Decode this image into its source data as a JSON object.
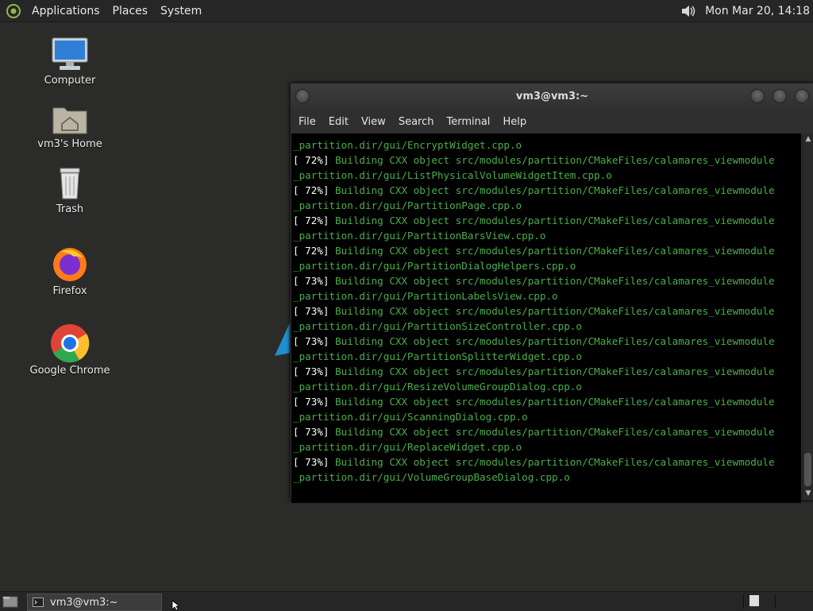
{
  "top_panel": {
    "menus": [
      "Applications",
      "Places",
      "System"
    ],
    "clock": "Mon Mar 20, 14:18"
  },
  "desktop": {
    "icons": [
      {
        "label": "Computer",
        "icon": "computer-icon"
      },
      {
        "label": "vm3's Home",
        "icon": "home-folder-icon"
      },
      {
        "label": "Trash",
        "icon": "trash-icon"
      },
      {
        "label": "Firefox",
        "icon": "firefox-icon"
      },
      {
        "label": "Google Chrome",
        "icon": "chrome-icon"
      }
    ]
  },
  "terminal": {
    "title": "vm3@vm3:~",
    "menu": [
      "File",
      "Edit",
      "View",
      "Search",
      "Terminal",
      "Help"
    ],
    "lines": [
      {
        "pct": "",
        "text": "",
        "cont": "_partition.dir/gui/EncryptWidget.cpp.o"
      },
      {
        "pct": "[ 72%]",
        "text": " Building CXX object src/modules/partition/CMakeFiles/calamares_viewmodule",
        "cont": ""
      },
      {
        "pct": "",
        "text": "",
        "cont": "_partition.dir/gui/ListPhysicalVolumeWidgetItem.cpp.o"
      },
      {
        "pct": "[ 72%]",
        "text": " Building CXX object src/modules/partition/CMakeFiles/calamares_viewmodule",
        "cont": ""
      },
      {
        "pct": "",
        "text": "",
        "cont": "_partition.dir/gui/PartitionPage.cpp.o"
      },
      {
        "pct": "[ 72%]",
        "text": " Building CXX object src/modules/partition/CMakeFiles/calamares_viewmodule",
        "cont": ""
      },
      {
        "pct": "",
        "text": "",
        "cont": "_partition.dir/gui/PartitionBarsView.cpp.o"
      },
      {
        "pct": "[ 72%]",
        "text": " Building CXX object src/modules/partition/CMakeFiles/calamares_viewmodule",
        "cont": ""
      },
      {
        "pct": "",
        "text": "",
        "cont": "_partition.dir/gui/PartitionDialogHelpers.cpp.o"
      },
      {
        "pct": "[ 73%]",
        "text": " Building CXX object src/modules/partition/CMakeFiles/calamares_viewmodule",
        "cont": ""
      },
      {
        "pct": "",
        "text": "",
        "cont": "_partition.dir/gui/PartitionLabelsView.cpp.o"
      },
      {
        "pct": "[ 73%]",
        "text": " Building CXX object src/modules/partition/CMakeFiles/calamares_viewmodule",
        "cont": ""
      },
      {
        "pct": "",
        "text": "",
        "cont": "_partition.dir/gui/PartitionSizeController.cpp.o"
      },
      {
        "pct": "[ 73%]",
        "text": " Building CXX object src/modules/partition/CMakeFiles/calamares_viewmodule",
        "cont": ""
      },
      {
        "pct": "",
        "text": "",
        "cont": "_partition.dir/gui/PartitionSplitterWidget.cpp.o"
      },
      {
        "pct": "[ 73%]",
        "text": " Building CXX object src/modules/partition/CMakeFiles/calamares_viewmodule",
        "cont": ""
      },
      {
        "pct": "",
        "text": "",
        "cont": "_partition.dir/gui/ResizeVolumeGroupDialog.cpp.o"
      },
      {
        "pct": "[ 73%]",
        "text": " Building CXX object src/modules/partition/CMakeFiles/calamares_viewmodule",
        "cont": ""
      },
      {
        "pct": "",
        "text": "",
        "cont": "_partition.dir/gui/ScanningDialog.cpp.o"
      },
      {
        "pct": "[ 73%]",
        "text": " Building CXX object src/modules/partition/CMakeFiles/calamares_viewmodule",
        "cont": ""
      },
      {
        "pct": "",
        "text": "",
        "cont": "_partition.dir/gui/ReplaceWidget.cpp.o"
      },
      {
        "pct": "[ 73%]",
        "text": " Building CXX object src/modules/partition/CMakeFiles/calamares_viewmodule",
        "cont": ""
      },
      {
        "pct": "",
        "text": "",
        "cont": "_partition.dir/gui/VolumeGroupBaseDialog.cpp.o"
      }
    ]
  },
  "taskbar": {
    "task_label": "vm3@vm3:~"
  },
  "colors": {
    "terminal_green": "#4bae4b",
    "terminal_bg": "#000000",
    "panel_bg": "#262626",
    "desktop_bg": "#2b2b29"
  }
}
